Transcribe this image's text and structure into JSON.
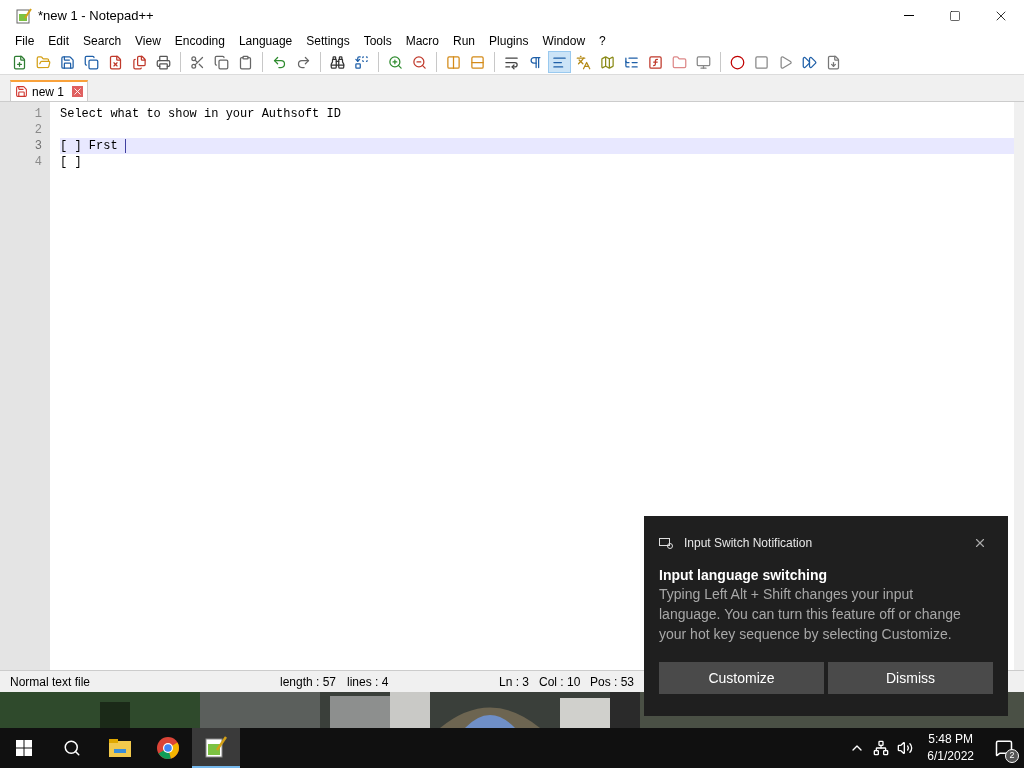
{
  "window": {
    "title": "*new 1 - Notepad++"
  },
  "menu": [
    "File",
    "Edit",
    "Search",
    "View",
    "Encoding",
    "Language",
    "Settings",
    "Tools",
    "Macro",
    "Run",
    "Plugins",
    "Window",
    "?"
  ],
  "toolbar": [
    {
      "kind": "new",
      "pressed": false
    },
    {
      "kind": "open",
      "pressed": false
    },
    {
      "kind": "save",
      "pressed": false
    },
    {
      "kind": "save-all",
      "pressed": false
    },
    {
      "kind": "close",
      "pressed": false
    },
    {
      "kind": "close-all",
      "pressed": false
    },
    {
      "kind": "print",
      "pressed": false
    },
    {
      "kind": "sep"
    },
    {
      "kind": "cut",
      "pressed": false
    },
    {
      "kind": "copy",
      "pressed": false
    },
    {
      "kind": "paste",
      "pressed": false
    },
    {
      "kind": "sep"
    },
    {
      "kind": "undo",
      "pressed": false
    },
    {
      "kind": "redo",
      "pressed": false
    },
    {
      "kind": "sep"
    },
    {
      "kind": "find",
      "pressed": false
    },
    {
      "kind": "replace",
      "pressed": false
    },
    {
      "kind": "sep"
    },
    {
      "kind": "zoom-in",
      "pressed": false
    },
    {
      "kind": "zoom-out",
      "pressed": false
    },
    {
      "kind": "sep"
    },
    {
      "kind": "sync-v",
      "pressed": false
    },
    {
      "kind": "sync-h",
      "pressed": false
    },
    {
      "kind": "sep"
    },
    {
      "kind": "wrap",
      "pressed": false
    },
    {
      "kind": "all-chars",
      "pressed": false
    },
    {
      "kind": "indent",
      "pressed": true
    },
    {
      "kind": "lang",
      "pressed": false
    },
    {
      "kind": "map",
      "pressed": false
    },
    {
      "kind": "list",
      "pressed": false
    },
    {
      "kind": "func",
      "pressed": false
    },
    {
      "kind": "folder",
      "pressed": false
    },
    {
      "kind": "monitor",
      "pressed": false
    },
    {
      "kind": "sep"
    },
    {
      "kind": "record",
      "pressed": false
    },
    {
      "kind": "stop",
      "pressed": false
    },
    {
      "kind": "play",
      "pressed": false
    },
    {
      "kind": "play-multi",
      "pressed": false
    },
    {
      "kind": "save-macro",
      "pressed": false
    }
  ],
  "tabs": [
    {
      "label": "new 1",
      "selected": true,
      "modified": true
    }
  ],
  "editor": {
    "lines": [
      {
        "number": "1",
        "text": "Select what to show in your Authsoft ID",
        "current": false
      },
      {
        "number": "2",
        "current": false
      },
      {
        "number": "3",
        "text": "[ ] Frst ",
        "current": true
      },
      {
        "number": "4",
        "text": "[ ]",
        "current": false
      }
    ]
  },
  "status_bar": {
    "file_type": "Normal text file",
    "length": "length : 57",
    "lines": "lines : 4",
    "ln": "Ln : 3",
    "col": "Col : 10",
    "pos": "Pos : 53"
  },
  "notification": {
    "app": "Input Switch Notification",
    "title": "Input language switching",
    "body": "Typing Left Alt + Shift changes your input language. You can turn this feature off or change your hot key sequence by selecting Customize.",
    "buttons": [
      "Customize",
      "Dismiss"
    ]
  },
  "taskbar": {
    "apps": [
      {
        "kind": "explorer",
        "active": false
      },
      {
        "kind": "chrome",
        "active": false
      },
      {
        "kind": "notepad",
        "active": true
      }
    ],
    "time": "5:48 PM",
    "date": "6/1/2022",
    "notifications": "2"
  }
}
